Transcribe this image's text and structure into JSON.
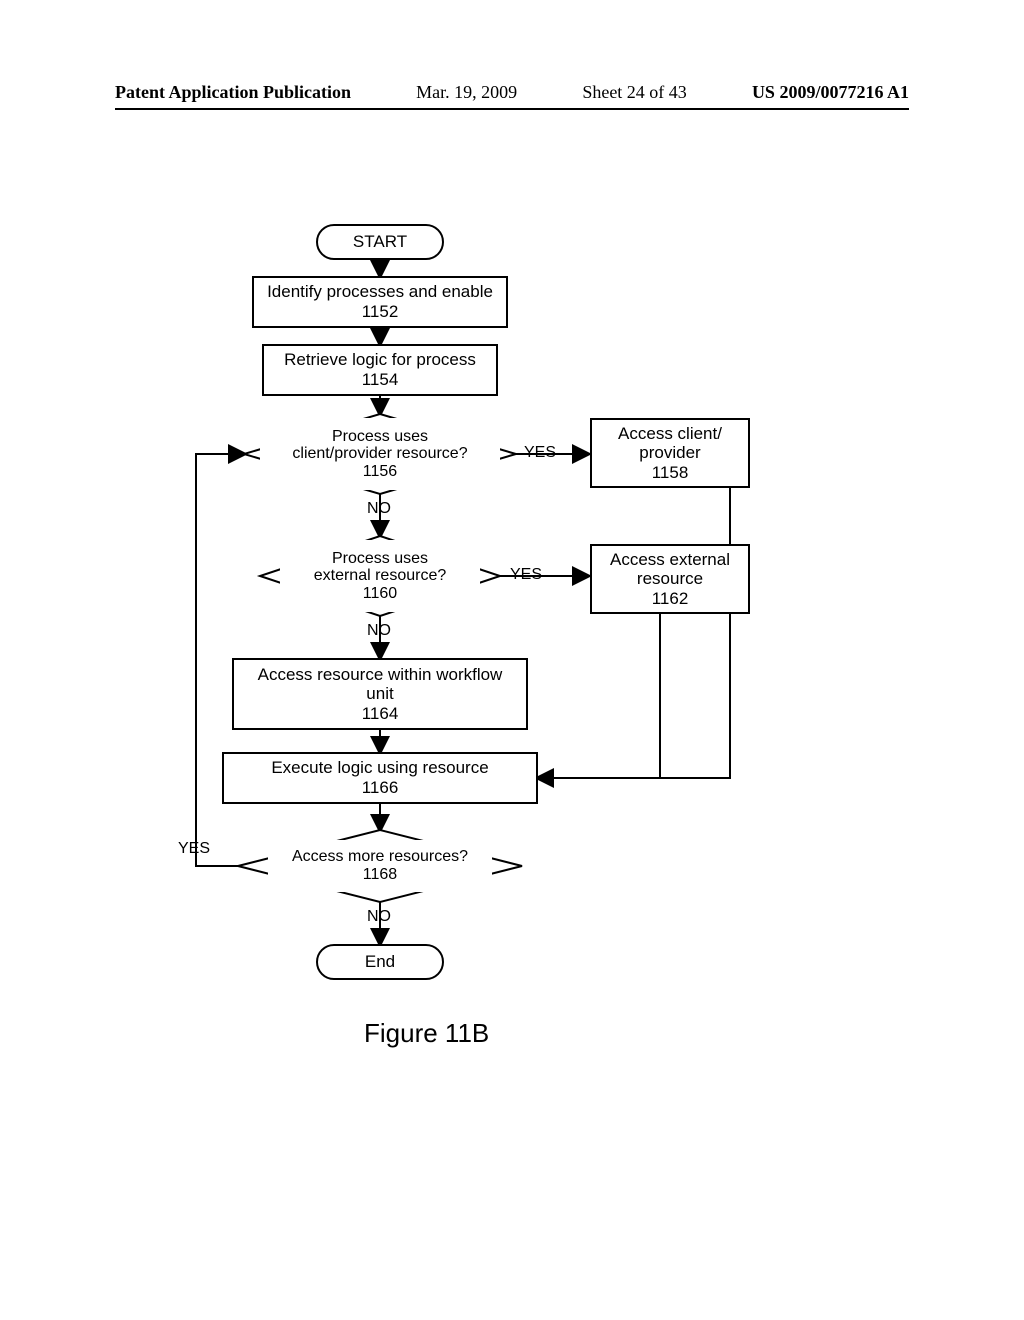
{
  "header": {
    "pub": "Patent Application Publication",
    "date": "Mar. 19, 2009",
    "sheet": "Sheet 24 of 43",
    "docket": "US 2009/0077216 A1"
  },
  "nodes": {
    "start": "START",
    "step_1152_l1": "Identify processes and enable",
    "step_1152_l2": "1152",
    "step_1154_l1": "Retrieve logic for process",
    "step_1154_l2": "1154",
    "dec_1156_l1": "Process uses",
    "dec_1156_l2": "client/provider resource?",
    "dec_1156_l3": "1156",
    "step_1158_l1": "Access client/",
    "step_1158_l2": "provider",
    "step_1158_l3": "1158",
    "dec_1160_l1": "Process uses",
    "dec_1160_l2": "external resource?",
    "dec_1160_l3": "1160",
    "step_1162_l1": "Access external",
    "step_1162_l2": "resource",
    "step_1162_l3": "1162",
    "step_1164_l1": "Access resource within workflow",
    "step_1164_l2": "unit",
    "step_1164_l3": "1164",
    "step_1166_l1": "Execute logic using resource",
    "step_1166_l2": "1166",
    "dec_1168_l1": "Access more resources?",
    "dec_1168_l2": "1168",
    "end": "End"
  },
  "labels": {
    "yes": "YES",
    "no": "NO"
  },
  "figure": "Figure 11B"
}
